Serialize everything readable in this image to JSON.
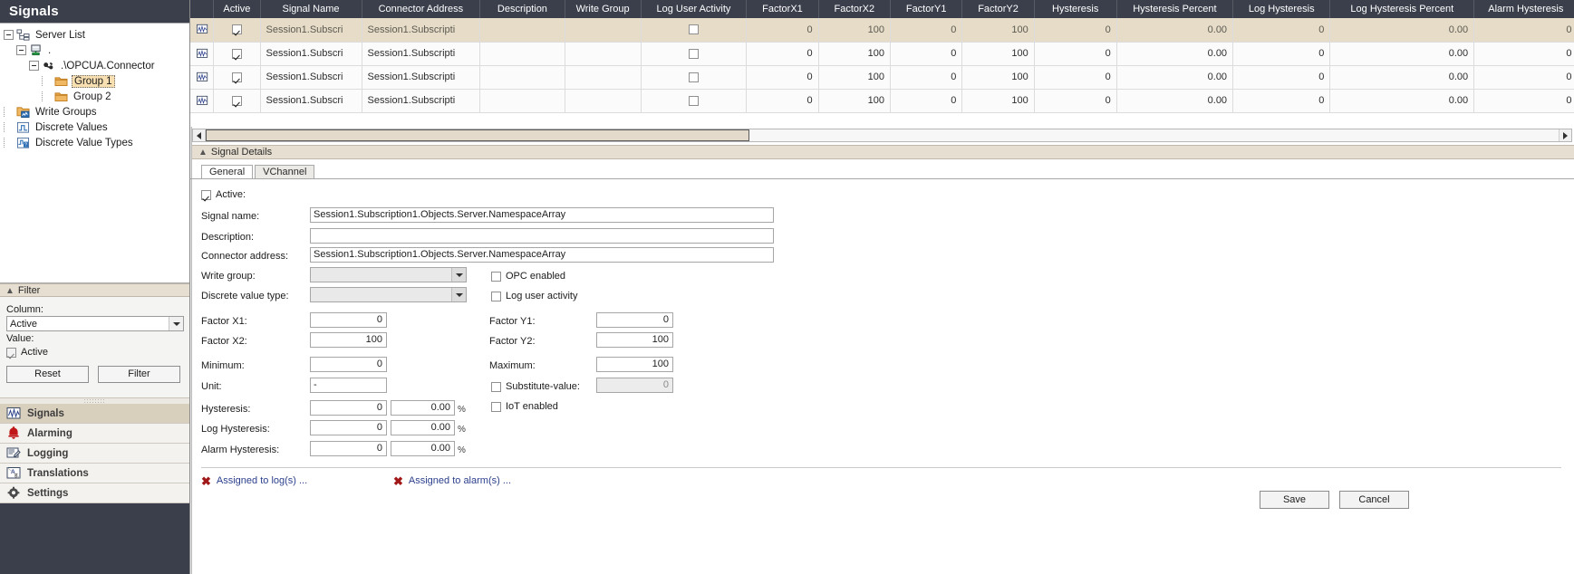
{
  "sidebar": {
    "title": "Signals",
    "tree": [
      {
        "label": "Server List",
        "icon": "server-list-icon",
        "depth": 0,
        "expander": true,
        "selected": false
      },
      {
        "label": ".",
        "icon": "server-icon",
        "depth": 1,
        "expander": true,
        "selected": false
      },
      {
        "label": ".\\OPCUA.Connector",
        "icon": "connector-icon",
        "depth": 2,
        "expander": true,
        "selected": false
      },
      {
        "label": "Group 1",
        "icon": "folder-icon",
        "depth": 3,
        "expander": false,
        "selected": true
      },
      {
        "label": "Group 2",
        "icon": "folder-icon",
        "depth": 3,
        "expander": false,
        "selected": false
      },
      {
        "label": "Write Groups",
        "icon": "write-groups-icon",
        "depth": 0,
        "expander": false,
        "selected": false
      },
      {
        "label": "Discrete Values",
        "icon": "discrete-values-icon",
        "depth": 0,
        "expander": false,
        "selected": false
      },
      {
        "label": "Discrete Value Types",
        "icon": "discrete-value-types-icon",
        "depth": 0,
        "expander": false,
        "selected": false
      }
    ],
    "filter": {
      "header": "Filter",
      "column_label": "Column:",
      "column_value": "Active",
      "value_label": "Value:",
      "active_checkbox_label": "Active",
      "active_checked": true,
      "reset_button": "Reset",
      "filter_button": "Filter"
    },
    "nav": [
      {
        "label": "Signals",
        "icon": "signals-icon",
        "active": true
      },
      {
        "label": "Alarming",
        "icon": "bell-icon",
        "active": false
      },
      {
        "label": "Logging",
        "icon": "logging-icon",
        "active": false
      },
      {
        "label": "Translations",
        "icon": "translations-icon",
        "active": false
      },
      {
        "label": "Settings",
        "icon": "gear-icon",
        "active": false
      }
    ]
  },
  "grid": {
    "columns": [
      "Active",
      "Signal Name",
      "Connector Address",
      "Description",
      "Write Group",
      "Log User Activity",
      "FactorX1",
      "FactorX2",
      "FactorY1",
      "FactorY2",
      "Hysteresis",
      "Hysteresis Percent",
      "Log Hysteresis",
      "Log Hysteresis Percent",
      "Alarm Hysteresis",
      "Alarm Hysteresis"
    ],
    "rows": [
      {
        "selected": true,
        "active": true,
        "signal_name": "Session1.Subscri",
        "connector_address": "Session1.Subscripti",
        "description": "",
        "write_group": "",
        "log_user_activity": false,
        "factor_x1": "0",
        "factor_x2": "100",
        "factor_y1": "0",
        "factor_y2": "100",
        "hysteresis": "0",
        "hysteresis_percent": "0.00",
        "log_hysteresis": "0",
        "log_hysteresis_percent": "0.00",
        "alarm_hysteresis": "0",
        "alarm_hysteresis_percent": ""
      },
      {
        "selected": false,
        "active": true,
        "signal_name": "Session1.Subscri",
        "connector_address": "Session1.Subscripti",
        "description": "",
        "write_group": "",
        "log_user_activity": false,
        "factor_x1": "0",
        "factor_x2": "100",
        "factor_y1": "0",
        "factor_y2": "100",
        "hysteresis": "0",
        "hysteresis_percent": "0.00",
        "log_hysteresis": "0",
        "log_hysteresis_percent": "0.00",
        "alarm_hysteresis": "0",
        "alarm_hysteresis_percent": ""
      },
      {
        "selected": false,
        "active": true,
        "signal_name": "Session1.Subscri",
        "connector_address": "Session1.Subscripti",
        "description": "",
        "write_group": "",
        "log_user_activity": false,
        "factor_x1": "0",
        "factor_x2": "100",
        "factor_y1": "0",
        "factor_y2": "100",
        "hysteresis": "0",
        "hysteresis_percent": "0.00",
        "log_hysteresis": "0",
        "log_hysteresis_percent": "0.00",
        "alarm_hysteresis": "0",
        "alarm_hysteresis_percent": ""
      },
      {
        "selected": false,
        "active": true,
        "signal_name": "Session1.Subscri",
        "connector_address": "Session1.Subscripti",
        "description": "",
        "write_group": "",
        "log_user_activity": false,
        "factor_x1": "0",
        "factor_x2": "100",
        "factor_y1": "0",
        "factor_y2": "100",
        "hysteresis": "0",
        "hysteresis_percent": "0.00",
        "log_hysteresis": "0",
        "log_hysteresis_percent": "0.00",
        "alarm_hysteresis": "0",
        "alarm_hysteresis_percent": ""
      }
    ]
  },
  "details": {
    "header": "Signal Details",
    "tabs": [
      {
        "label": "General",
        "active": true
      },
      {
        "label": "VChannel",
        "active": false
      }
    ],
    "active_label": "Active:",
    "active_checked": true,
    "signal_name_label": "Signal name:",
    "signal_name_value": "Session1.Subscription1.Objects.Server.NamespaceArray",
    "description_label": "Description:",
    "description_value": "",
    "connector_address_label": "Connector address:",
    "connector_address_value": "Session1.Subscription1.Objects.Server.NamespaceArray",
    "write_group_label": "Write group:",
    "write_group_value": "",
    "discrete_value_type_label": "Discrete value type:",
    "discrete_value_type_value": "",
    "opc_enabled_label": "OPC enabled",
    "opc_enabled_checked": false,
    "log_user_activity_label": "Log user activity",
    "log_user_activity_checked": false,
    "factor_x1_label": "Factor X1:",
    "factor_x1_value": "0",
    "factor_x2_label": "Factor X2:",
    "factor_x2_value": "100",
    "factor_y1_label": "Factor Y1:",
    "factor_y1_value": "0",
    "factor_y2_label": "Factor Y2:",
    "factor_y2_value": "100",
    "minimum_label": "Minimum:",
    "minimum_value": "0",
    "maximum_label": "Maximum:",
    "maximum_value": "100",
    "unit_label": "Unit:",
    "unit_value": "-",
    "substitute_value_label": "Substitute-value:",
    "substitute_value_checked": false,
    "substitute_value_value": "0",
    "iot_enabled_label": "IoT enabled",
    "iot_enabled_checked": false,
    "hysteresis_label": "Hysteresis:",
    "hysteresis_value": "0",
    "hysteresis_percent_value": "0.00",
    "log_hysteresis_label": "Log Hysteresis:",
    "log_hysteresis_value": "0",
    "log_hysteresis_percent_value": "0.00",
    "alarm_hysteresis_label": "Alarm Hysteresis:",
    "alarm_hysteresis_value": "0",
    "alarm_hysteresis_percent_value": "0.00",
    "percent_symbol": "%",
    "assigned_logs_link": "Assigned to log(s) ...",
    "assigned_alarms_link": "Assigned to alarm(s) ...",
    "save_button": "Save",
    "cancel_button": "Cancel"
  },
  "colors": {
    "header_bar": "#3a3f4b",
    "selection": "#e6dcc8",
    "panel_accent": "#e6ded0",
    "link": "#2b3f8c",
    "error_x": "#a01818"
  }
}
